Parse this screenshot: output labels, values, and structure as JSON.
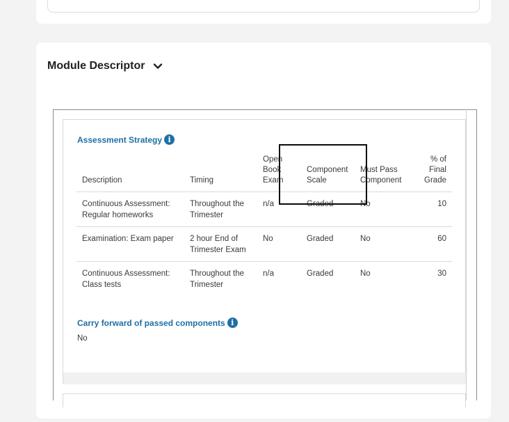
{
  "card": {
    "title": "Module Descriptor"
  },
  "assessment": {
    "heading": "Assessment Strategy",
    "headers": {
      "description": "Description",
      "timing": "Timing",
      "open_book": "Open Book Exam",
      "scale": "Component Scale",
      "must_pass": "Must Pass Component",
      "pct": "% of Final Grade"
    },
    "rows": [
      {
        "description": "Continuous Assessment: Regular homeworks",
        "timing": "Throughout the Trimester",
        "open_book": "n/a",
        "scale": "Graded",
        "must_pass": "No",
        "pct": "10"
      },
      {
        "description": "Examination: Exam paper",
        "timing": "2 hour End of Trimester Exam",
        "open_book": "No",
        "scale": "Graded",
        "must_pass": "No",
        "pct": "60"
      },
      {
        "description": "Continuous Assessment: Class tests",
        "timing": "Throughout the Trimester",
        "open_book": "n/a",
        "scale": "Graded",
        "must_pass": "No",
        "pct": "30"
      }
    ]
  },
  "carry_forward": {
    "heading": "Carry forward of passed components",
    "value": "No"
  },
  "icons": {
    "info": "info-icon",
    "expand": "chevron-down-icon"
  },
  "colors": {
    "link_blue": "#1f6fa6",
    "page_bg": "#f3f3f4"
  }
}
